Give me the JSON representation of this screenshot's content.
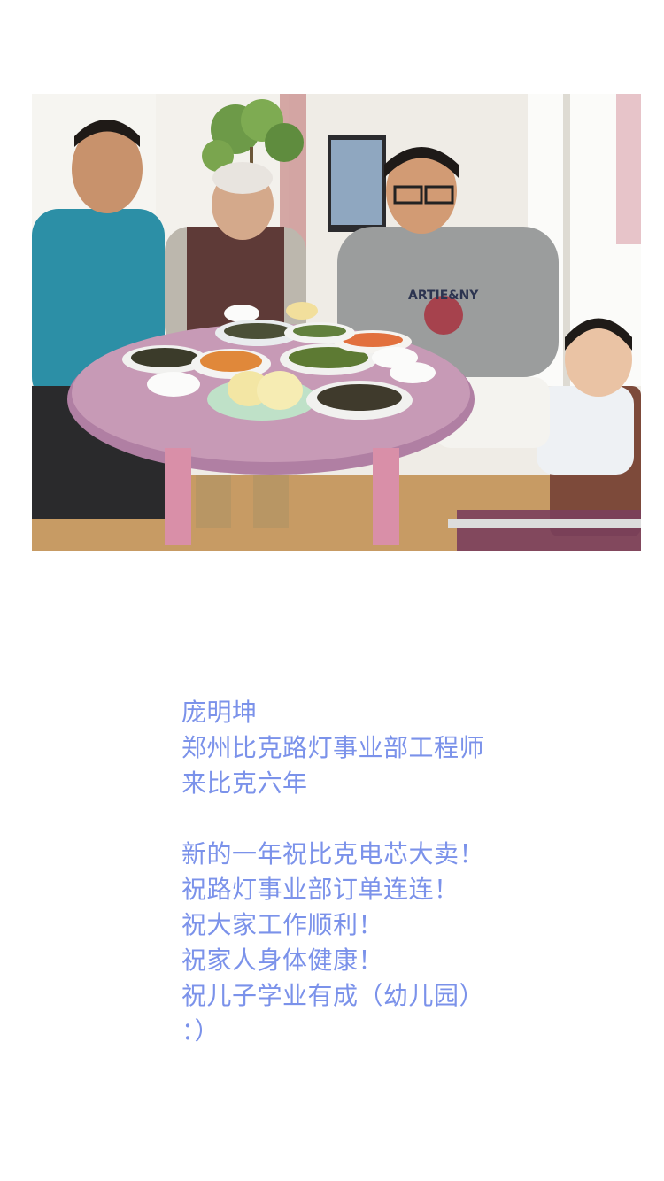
{
  "photo": {
    "alt": "",
    "shirt_text": "ARTIE&NY"
  },
  "profile": {
    "name": "庞明坤",
    "title": "郑州比克路灯事业部工程师",
    "tenure": "来比克六年"
  },
  "wishes": [
    "新的一年祝比克电芯大卖！",
    "祝路灯事业部订单连连！",
    "祝大家工作顺利！",
    "祝家人身体健康！",
    "祝儿子学业有成（幼儿园）",
    "：）"
  ],
  "colors": {
    "text": "#7b92ea",
    "background": "#ffffff"
  }
}
